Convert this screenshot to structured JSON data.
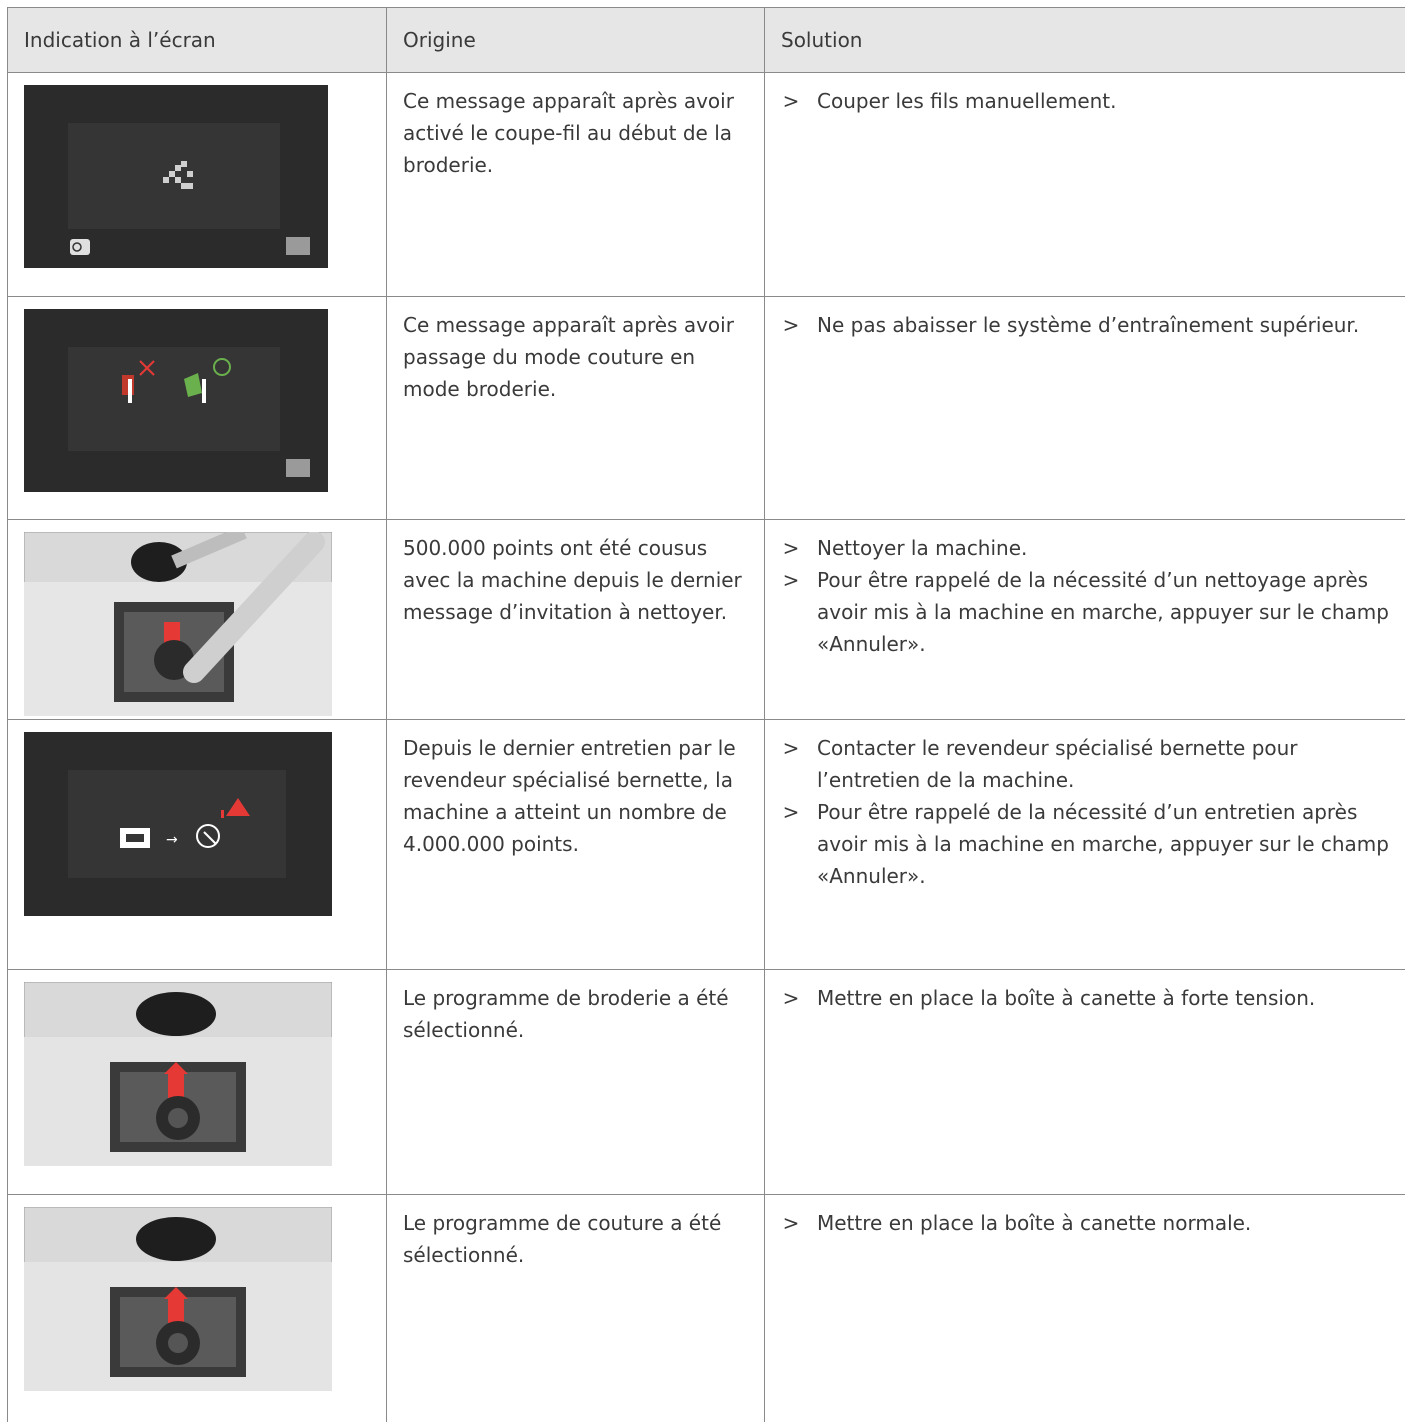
{
  "table": {
    "headers": [
      "Indication à l’écran",
      "Origine",
      "Solution"
    ],
    "rows": [
      {
        "screen_icon": "thread-cutter-screen",
        "origin": "Ce message apparaît après avoir activé le coupe-fil au début de la broderie.",
        "solutions": [
          "Couper les fils manuellement."
        ]
      },
      {
        "screen_icon": "feed-system-screen",
        "origin": "Ce message apparaît après avoir passage du mode couture en mode broderie.",
        "solutions": [
          "Ne pas abaisser le système d’entraînement supérieur."
        ]
      },
      {
        "screen_icon": "cleaning-illustration",
        "origin": "500.000 points ont été cousus avec la machine depuis le dernier message d’invitation à nettoyer.",
        "solutions": [
          "Nettoyer la machine.",
          "Pour être rappelé de la nécessité d’un nettoyage après avoir mis à la machine en marche, appuyer sur le champ «Annuler»."
        ]
      },
      {
        "screen_icon": "service-screen",
        "origin": "Depuis le dernier entretien par le revendeur spécialisé bernette, la machine a atteint un nombre de 4.000.000 points.",
        "solutions": [
          "Contacter le revendeur spécialisé bernette pour l’entretien de la machine.",
          "Pour être rappelé de la nécessité d’un entretien après avoir mis à la machine en marche, appuyer sur le champ «Annuler»."
        ]
      },
      {
        "screen_icon": "bobbin-case-illustration",
        "origin": "Le programme de broderie a été sélectionné.",
        "solutions": [
          "Mettre en place la boîte à canette à forte tension."
        ]
      },
      {
        "screen_icon": "bobbin-case-illustration",
        "origin": "Le programme de couture a été sélectionné.",
        "solutions": [
          "Mettre en place la boîte à canette normale."
        ]
      }
    ],
    "bullet_glyph": ">"
  },
  "colors": {
    "header_bg": "#e6e6e6",
    "border": "#8a8a8a",
    "screen_bg": "#2b2b2b",
    "accent_red": "#e53935",
    "accent_green": "#6ab04c"
  }
}
